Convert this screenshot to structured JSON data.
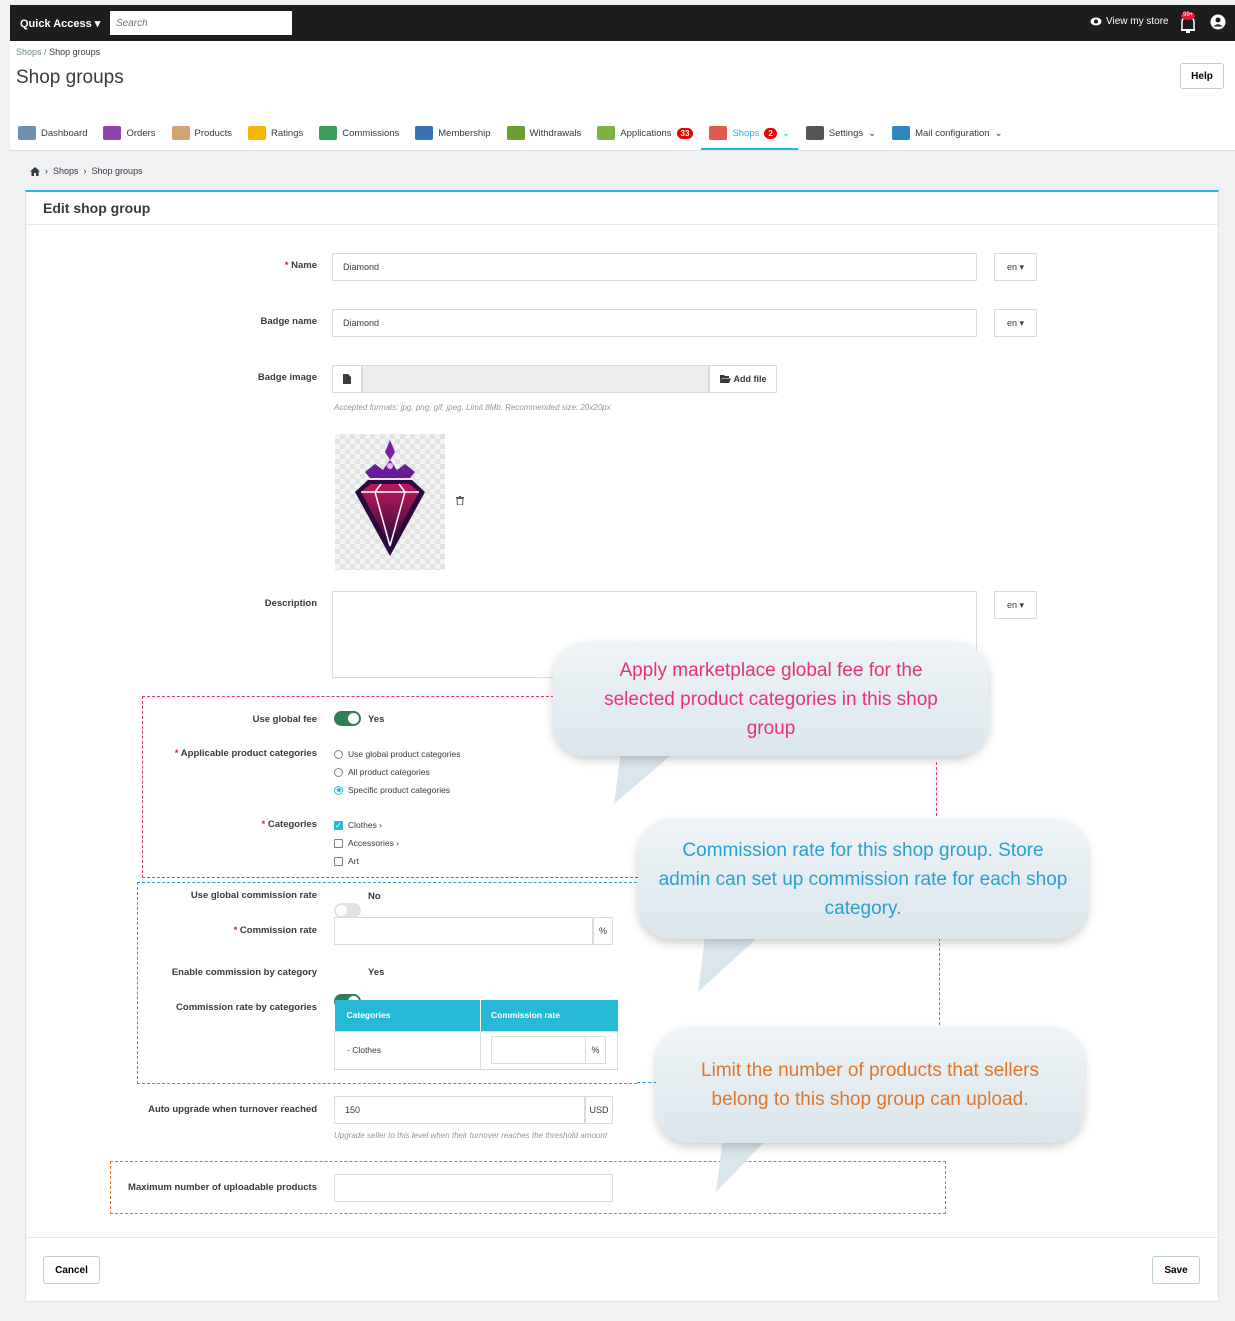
{
  "topbar": {
    "quick_access": "Quick Access ▾",
    "search_placeholder": "Search",
    "view_store": "View my store",
    "bell_count": "99+"
  },
  "header": {
    "breadcrumb_root": "Shops",
    "breadcrumb_sep": "/",
    "breadcrumb_current": "Shop groups",
    "title": "Shop groups",
    "help_label": "Help"
  },
  "tabs": [
    {
      "label": "Dashboard",
      "icon": "dashboard-icon",
      "color": "#6c8fb2"
    },
    {
      "label": "Orders",
      "icon": "cart-icon",
      "color": "#8e44ad"
    },
    {
      "label": "Products",
      "icon": "box-icon",
      "color": "#d4a373"
    },
    {
      "label": "Ratings",
      "icon": "star-icon",
      "color": "#f5b800"
    },
    {
      "label": "Commissions",
      "icon": "money-icon",
      "color": "#3a9d5d"
    },
    {
      "label": "Membership",
      "icon": "membership-icon",
      "color": "#3b6fb6"
    },
    {
      "label": "Withdrawals",
      "icon": "withdraw-icon",
      "color": "#6a9e2f"
    },
    {
      "label": "Applications",
      "icon": "check-icon",
      "color": "#7cb342",
      "badge": "33"
    },
    {
      "label": "Shops",
      "icon": "shop-icon",
      "color": "#e05a4e",
      "badge": "2",
      "caret": "⌄",
      "active": true
    },
    {
      "label": "Settings",
      "icon": "gears-icon",
      "color": "#555555",
      "caret": "⌄"
    },
    {
      "label": "Mail configuration",
      "icon": "mail-icon",
      "color": "#2e86c1",
      "caret": "⌄"
    }
  ],
  "breadcrumb2": {
    "sep": "›",
    "shops": "Shops",
    "current": "Shop groups"
  },
  "form": {
    "title": "Edit shop group",
    "required_mark": "*",
    "name_label": "Name",
    "name_value": "Diamond",
    "lang": "en ▾",
    "badge_name_label": "Badge name",
    "badge_name_value": "Diamond",
    "badge_image_label": "Badge image",
    "add_file": "Add file",
    "formats_help": "Accepted formats: jpg, png, gif, jpeg. Limit 8Mb. Recommended size: 20x20px",
    "description_label": "Description",
    "use_global_fee_label": "Use global fee",
    "use_global_fee_value": "Yes",
    "applicable_label": "Applicable product categories",
    "applicable_options": [
      "Use global product categories",
      "All product categories",
      "Specific product categories"
    ],
    "applicable_selected": 2,
    "categories_label": "Categories",
    "categories": [
      {
        "label": "Clothes ›",
        "checked": true
      },
      {
        "label": "Accessories ›",
        "checked": false
      },
      {
        "label": "Art",
        "checked": false
      }
    ],
    "use_global_commission_label": "Use global commission rate",
    "use_global_commission_value": "No",
    "commission_rate_label": "Commission rate",
    "percent": "%",
    "enable_by_category_label": "Enable commission by category",
    "enable_by_category_value": "Yes",
    "rate_by_categories_label": "Commission rate by categories",
    "table_headers": [
      "Categories",
      "Commission rate"
    ],
    "table_rows": [
      {
        "category": "- Clothes"
      }
    ],
    "auto_upgrade_label": "Auto upgrade when turnover reached",
    "auto_upgrade_value": "150",
    "currency": "USD",
    "auto_upgrade_help": "Upgrade seller to this level when their turnover reaches the threshold amount",
    "max_products_label": "Maximum number of uploadable products",
    "cancel": "Cancel",
    "save": "Save"
  },
  "callouts": {
    "fee": "Apply marketplace global fee for the selected product categories in this shop group",
    "commission": "Commission rate for this shop group. Store admin can set up commission rate for each shop category.",
    "limit": "Limit the number of products that sellers belong to this shop group can upload."
  },
  "colors": {
    "accent": "#25b9d7",
    "toggle_on": "#2e7d5b",
    "callout_pink": "#e6317c",
    "callout_blue": "#2a9fd0",
    "callout_orange": "#e0762b",
    "required": "#e6193b"
  }
}
